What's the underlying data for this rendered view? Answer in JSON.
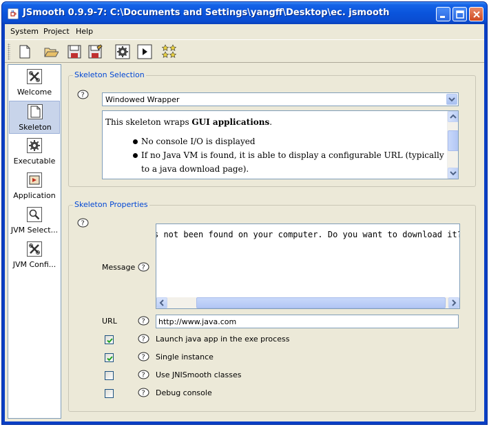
{
  "window": {
    "title": "JSmooth 0.9.9-7: C:\\Documents and Settings\\yangff\\Desktop\\ec. jsmooth"
  },
  "menu": [
    "System",
    "Project",
    "Help"
  ],
  "toolbar": {
    "icons": [
      "new-file-icon",
      "open-folder-icon",
      "save-icon",
      "save-as-icon",
      "compile-gear-icon",
      "run-icon",
      "stars-icon"
    ]
  },
  "sidebar": {
    "items": [
      {
        "label": "Welcome",
        "icon": "tools-icon",
        "selected": false
      },
      {
        "label": "Skeleton",
        "icon": "document-icon",
        "selected": true
      },
      {
        "label": "Executable",
        "icon": "gear-icon",
        "selected": false
      },
      {
        "label": "Application",
        "icon": "application-icon",
        "selected": false
      },
      {
        "label": "JVM Select...",
        "icon": "magnifier-icon",
        "selected": false
      },
      {
        "label": "JVM Confi...",
        "icon": "tools-icon",
        "selected": false
      }
    ]
  },
  "skeleton_selection": {
    "title": "Skeleton Selection",
    "selected_value": "Windowed Wrapper",
    "description": {
      "intro_prefix": "This skeleton wraps ",
      "intro_bold": "GUI applications",
      "intro_suffix": ".",
      "bullets": [
        "No console I/O is displayed",
        "If no Java VM is found, it is able to display a configurable URL (typically to a java download page)."
      ]
    }
  },
  "skeleton_properties": {
    "title": "Skeleton Properties",
    "message_label": "Message",
    "message_value": "s not been found on your computer. Do you want to download it?",
    "url_label": "URL",
    "url_value": "http://www.java.com",
    "options": [
      {
        "label": "Launch java app in the exe process",
        "checked": true
      },
      {
        "label": "Single instance",
        "checked": true
      },
      {
        "label": "Use JNISmooth classes",
        "checked": false
      },
      {
        "label": "Debug console",
        "checked": false
      }
    ]
  },
  "colors": {
    "titlebar": "#0a54dc",
    "group_title": "#0046d5",
    "frame_bg": "#ece9d8",
    "selection": "#c8d4ea"
  }
}
